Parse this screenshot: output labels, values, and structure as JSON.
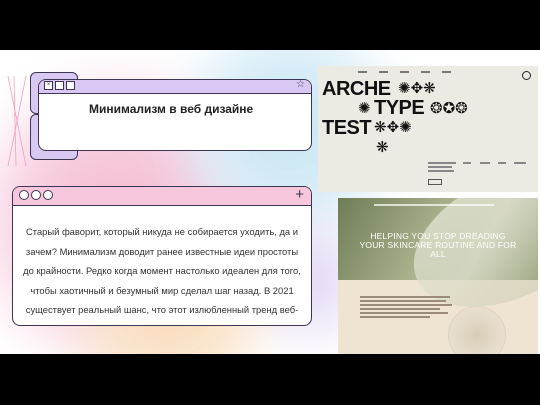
{
  "window_title_card": {
    "title": "Минимализм в веб дизайне",
    "star_icon": "star-icon"
  },
  "text_card": {
    "buttons": [
      "circle",
      "circle",
      "circle"
    ],
    "plus_label": "+",
    "body": "Старый фаворит, который никуда не собирается уходить, да и зачем? Минимализм доводит ранее известные идеи простоты до крайности. Редко когда момент настолько идеален для того, чтобы хаотичный и безумный мир сделал шаг назад. В 2021 существует реальный шанс, что этот излюбленный тренд веб-дизайна придется по нраву многим."
  },
  "screenshot_archetype": {
    "line1": "ARCHE",
    "line2": "TYPE",
    "line3": "TEST"
  },
  "screenshot_skincare": {
    "headline": "HELPING YOU STOP DREADING YOUR SKINCARE ROUTINE AND FOR ALL"
  },
  "colors": {
    "window_bar_purple": "#d9c8f3",
    "window_bar_pink": "#f6c6dc",
    "outline": "#3c3554"
  }
}
